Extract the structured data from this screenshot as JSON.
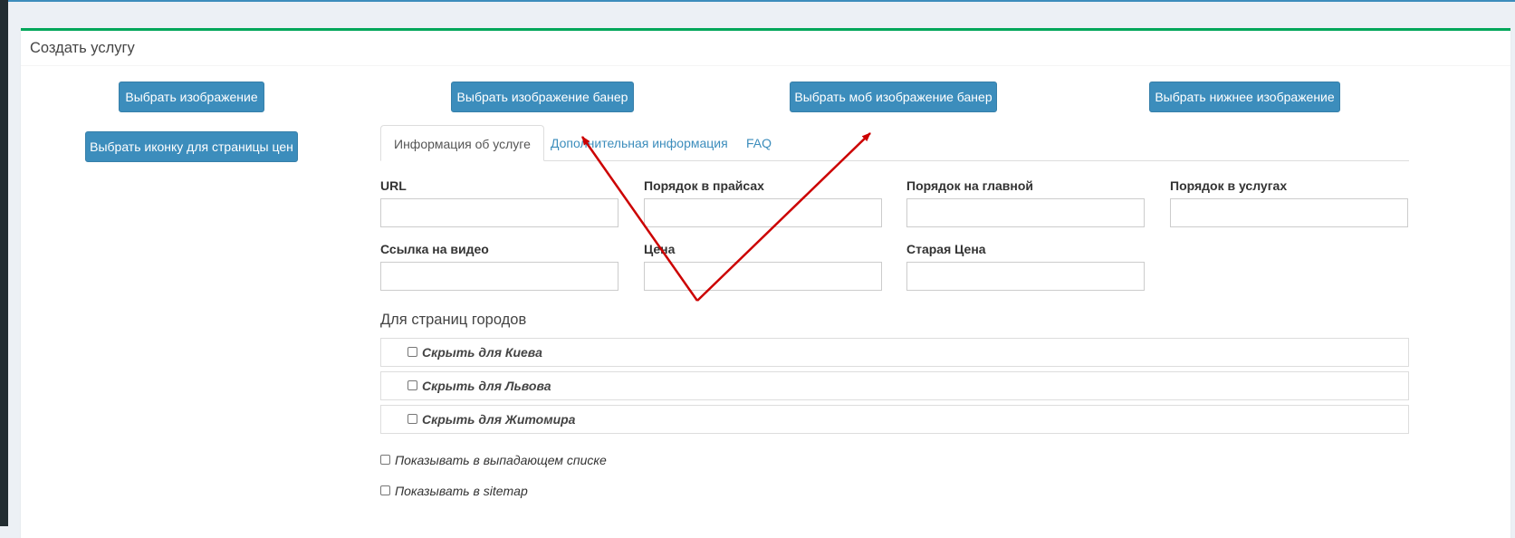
{
  "panel": {
    "title": "Создать услугу"
  },
  "image_buttons": {
    "select_image": "Выбрать изображение",
    "select_price_icon": "Выбрать иконку для страницы цен",
    "select_banner": "Выбрать изображение банер",
    "select_mobile_banner": "Выбрать моб изображение банер",
    "select_bottom_image": "Выбрать нижнее изображение"
  },
  "tabs": [
    {
      "label": "Информация об услуге",
      "active": true
    },
    {
      "label": "Дополнительная информация",
      "active": false
    },
    {
      "label": "FAQ",
      "active": false
    }
  ],
  "form": {
    "url": {
      "label": "URL",
      "value": ""
    },
    "price_order": {
      "label": "Порядок в прайсах",
      "value": ""
    },
    "main_order": {
      "label": "Порядок на главной",
      "value": ""
    },
    "services_order": {
      "label": "Порядок в услугах",
      "value": ""
    },
    "video_link": {
      "label": "Ссылка на видео",
      "value": ""
    },
    "price": {
      "label": "Цена",
      "value": ""
    },
    "old_price": {
      "label": "Старая Цена",
      "value": ""
    }
  },
  "city_section": {
    "title": "Для страниц городов",
    "items": [
      {
        "label": "Скрыть для Киева",
        "checked": false
      },
      {
        "label": "Скрыть для Львова",
        "checked": false
      },
      {
        "label": "Скрыть для Житомира",
        "checked": false
      }
    ]
  },
  "options": [
    {
      "label": "Показывать в выпадающем списке",
      "checked": false
    },
    {
      "label": "Показывать в sitemap",
      "checked": false
    }
  ],
  "colors": {
    "primary": "#3c8dbc",
    "box_top_border": "#00a65a",
    "annotation_arrow": "#cc0000"
  }
}
